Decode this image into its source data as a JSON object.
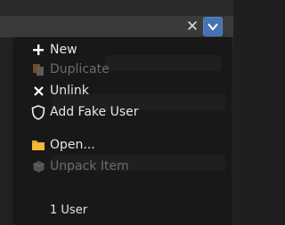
{
  "header": {
    "close_icon": "close-icon",
    "dropdown_icon": "chevron-down-icon",
    "accent": "#4772b3"
  },
  "menu": {
    "items": [
      {
        "label": "New",
        "icon": "plus-icon",
        "enabled": true
      },
      {
        "label": "Duplicate",
        "icon": "duplicate-icon",
        "enabled": false
      },
      {
        "label": "Unlink",
        "icon": "x-icon",
        "enabled": true
      },
      {
        "label": "Add Fake User",
        "icon": "shield-icon",
        "enabled": true
      },
      {
        "label": "Open...",
        "icon": "folder-icon",
        "enabled": true
      },
      {
        "label": "Unpack Item",
        "icon": "package-icon",
        "enabled": false
      }
    ],
    "users_count": "1 User"
  }
}
